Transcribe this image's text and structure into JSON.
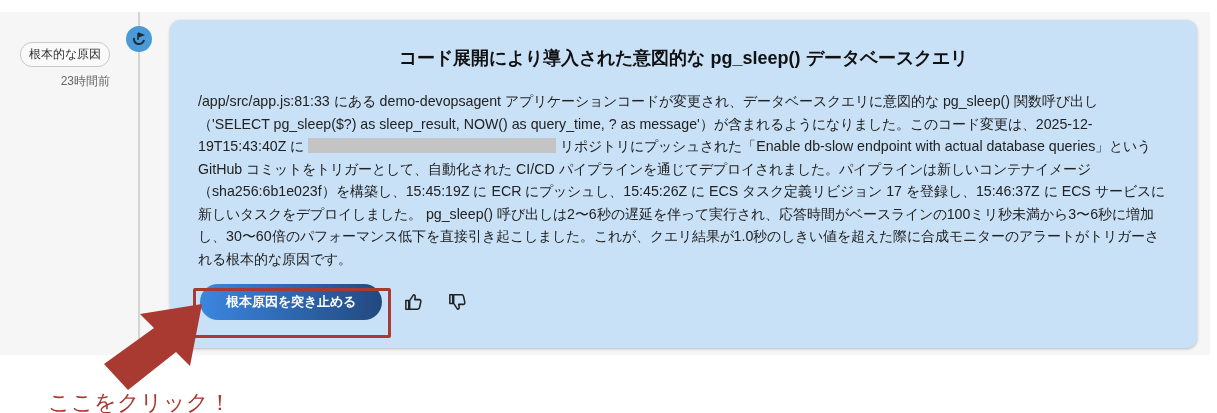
{
  "sidebar": {
    "tag": "根本的な原因",
    "time": "23時間前"
  },
  "card": {
    "title": "コード展開により導入された意図的な pg_sleep() データベースクエリ",
    "body_parts": [
      {
        "kind": "text",
        "text": "/app/src/app.js:81:33 にある demo-devopsagent アプリケーションコードが変更され、データベースクエリに意図的な pg_sleep() 関数呼び出し（'SELECT pg_sleep($?) as sleep_result, NOW() as query_time, ? as message'）が含まれるようになりました。このコード変更は、2025-12-19T15:43:40Z に "
      },
      {
        "kind": "redacted"
      },
      {
        "kind": "text",
        "text": " リポジトリにプッシュされた「Enable db-slow endpoint with actual database queries」という GitHub コミットをトリガーとして、自動化された CI/CD パイプラインを通じてデプロイされました。パイプラインは新しいコンテナイメージ（sha256:6b1e023f）を構築し、15:45:19Z に ECR にプッシュし、15:45:26Z に ECS タスク定義リビジョン 17 を登録し、15:46:37Z に ECS サービスに新しいタスクをデプロイしました。 pg_sleep() 呼び出しは2〜6秒の遅延を伴って実行され、応答時間がベースラインの100ミリ秒未満から3〜6秒に増加し、30〜60倍のパフォーマンス低下を直接引き起こしました。これが、クエリ結果が1.0秒のしきい値を超えた際に合成モニターのアラートがトリガーされる根本的な原因です。"
      }
    ],
    "button": "根本原因を突き止める",
    "feedback": [
      {
        "kind": "thumbs_up"
      },
      {
        "kind": "thumbs_down"
      }
    ]
  },
  "annotation": {
    "text": "ここをクリック！"
  }
}
